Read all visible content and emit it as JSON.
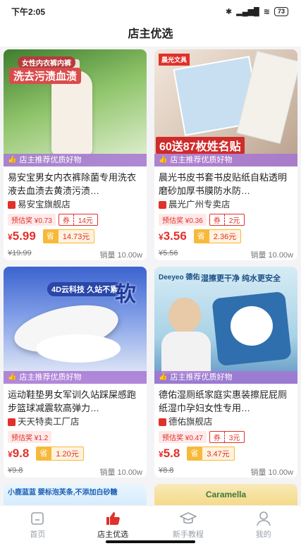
{
  "status": {
    "time": "下午2:05",
    "battery": "73"
  },
  "header": {
    "title": "店主优选"
  },
  "ribbon_text": "店主推荐优质好物",
  "products": [
    {
      "img_caption": "洗去污渍血渍",
      "img_sub": "女性内衣裤内裤",
      "title": "易安宝男女内衣裤除菌专用洗衣液去血渍去黄渍污渍…",
      "shop": "易安宝旗舰店",
      "est_label": "预估奖",
      "est_value": "¥0.73",
      "coupon_label": "券",
      "coupon_value": "14元",
      "price_yen": "¥",
      "price": "5.99",
      "save_label": "省",
      "save_value": "14.73元",
      "original": "¥19.99",
      "sales": "销量 10.00w",
      "colors": {
        "bg1": "#6aa84f",
        "bg2": "#cfe7b5"
      }
    },
    {
      "img_caption": "60送87枚姓名贴",
      "img_sub": "晨光文具",
      "title": "晨光书皮书套书皮贴纸自粘透明磨砂加厚书膜防水防…",
      "shop": "晨光广州专卖店",
      "est_label": "预估奖",
      "est_value": "¥0.36",
      "coupon_label": "券",
      "coupon_value": "2元",
      "price_yen": "¥",
      "price": "3.56",
      "save_label": "省",
      "save_value": "2.36元",
      "original": "¥5.56",
      "sales": "销量 10.00w",
      "colors": {
        "bg1": "#e8d6c8",
        "bg2": "#c94b4b"
      }
    },
    {
      "img_caption": "软",
      "img_sub": "4D云科技 久站不累",
      "title": "运动鞋垫男女军训久站踩屎感跑步篮球减震软高弹力…",
      "shop": "天天特卖工厂店",
      "est_label": "预估奖",
      "est_value": "¥1.2",
      "coupon_label": "",
      "coupon_value": "",
      "price_yen": "¥",
      "price": "9.8",
      "save_label": "省",
      "save_value": "1.20元",
      "original": "¥9.8",
      "sales": "销量 10.00w",
      "colors": {
        "bg1": "#4a6fd8",
        "bg2": "#e9edf7"
      }
    },
    {
      "img_caption": "湿擦更干净 纯水更安全",
      "img_sub": "Deeyeo 德佑",
      "title": "德佑湿厕纸家庭实惠装擦屁屁厕纸湿巾孕妇女性专用…",
      "shop": "德佑旗舰店",
      "est_label": "预估奖",
      "est_value": "¥0.47",
      "coupon_label": "券",
      "coupon_value": "3元",
      "price_yen": "¥",
      "price": "5.8",
      "save_label": "省",
      "save_value": "3.47元",
      "original": "¥8.8",
      "sales": "销量 10.00w",
      "colors": {
        "bg1": "#b9dbe9",
        "bg2": "#2f6fae"
      }
    }
  ],
  "partial_cards": [
    {
      "caption": "小鹿蓝蓝 婴标泡芙条,不添加白砂糖"
    },
    {
      "caption": "Caramella"
    }
  ],
  "tabs": [
    {
      "label": "首页",
      "icon": "home-icon",
      "active": false
    },
    {
      "label": "店主优选",
      "icon": "thumbs-up-icon",
      "active": true
    },
    {
      "label": "新手教程",
      "icon": "graduation-cap-icon",
      "active": false
    },
    {
      "label": "我的",
      "icon": "user-icon",
      "active": false
    }
  ]
}
